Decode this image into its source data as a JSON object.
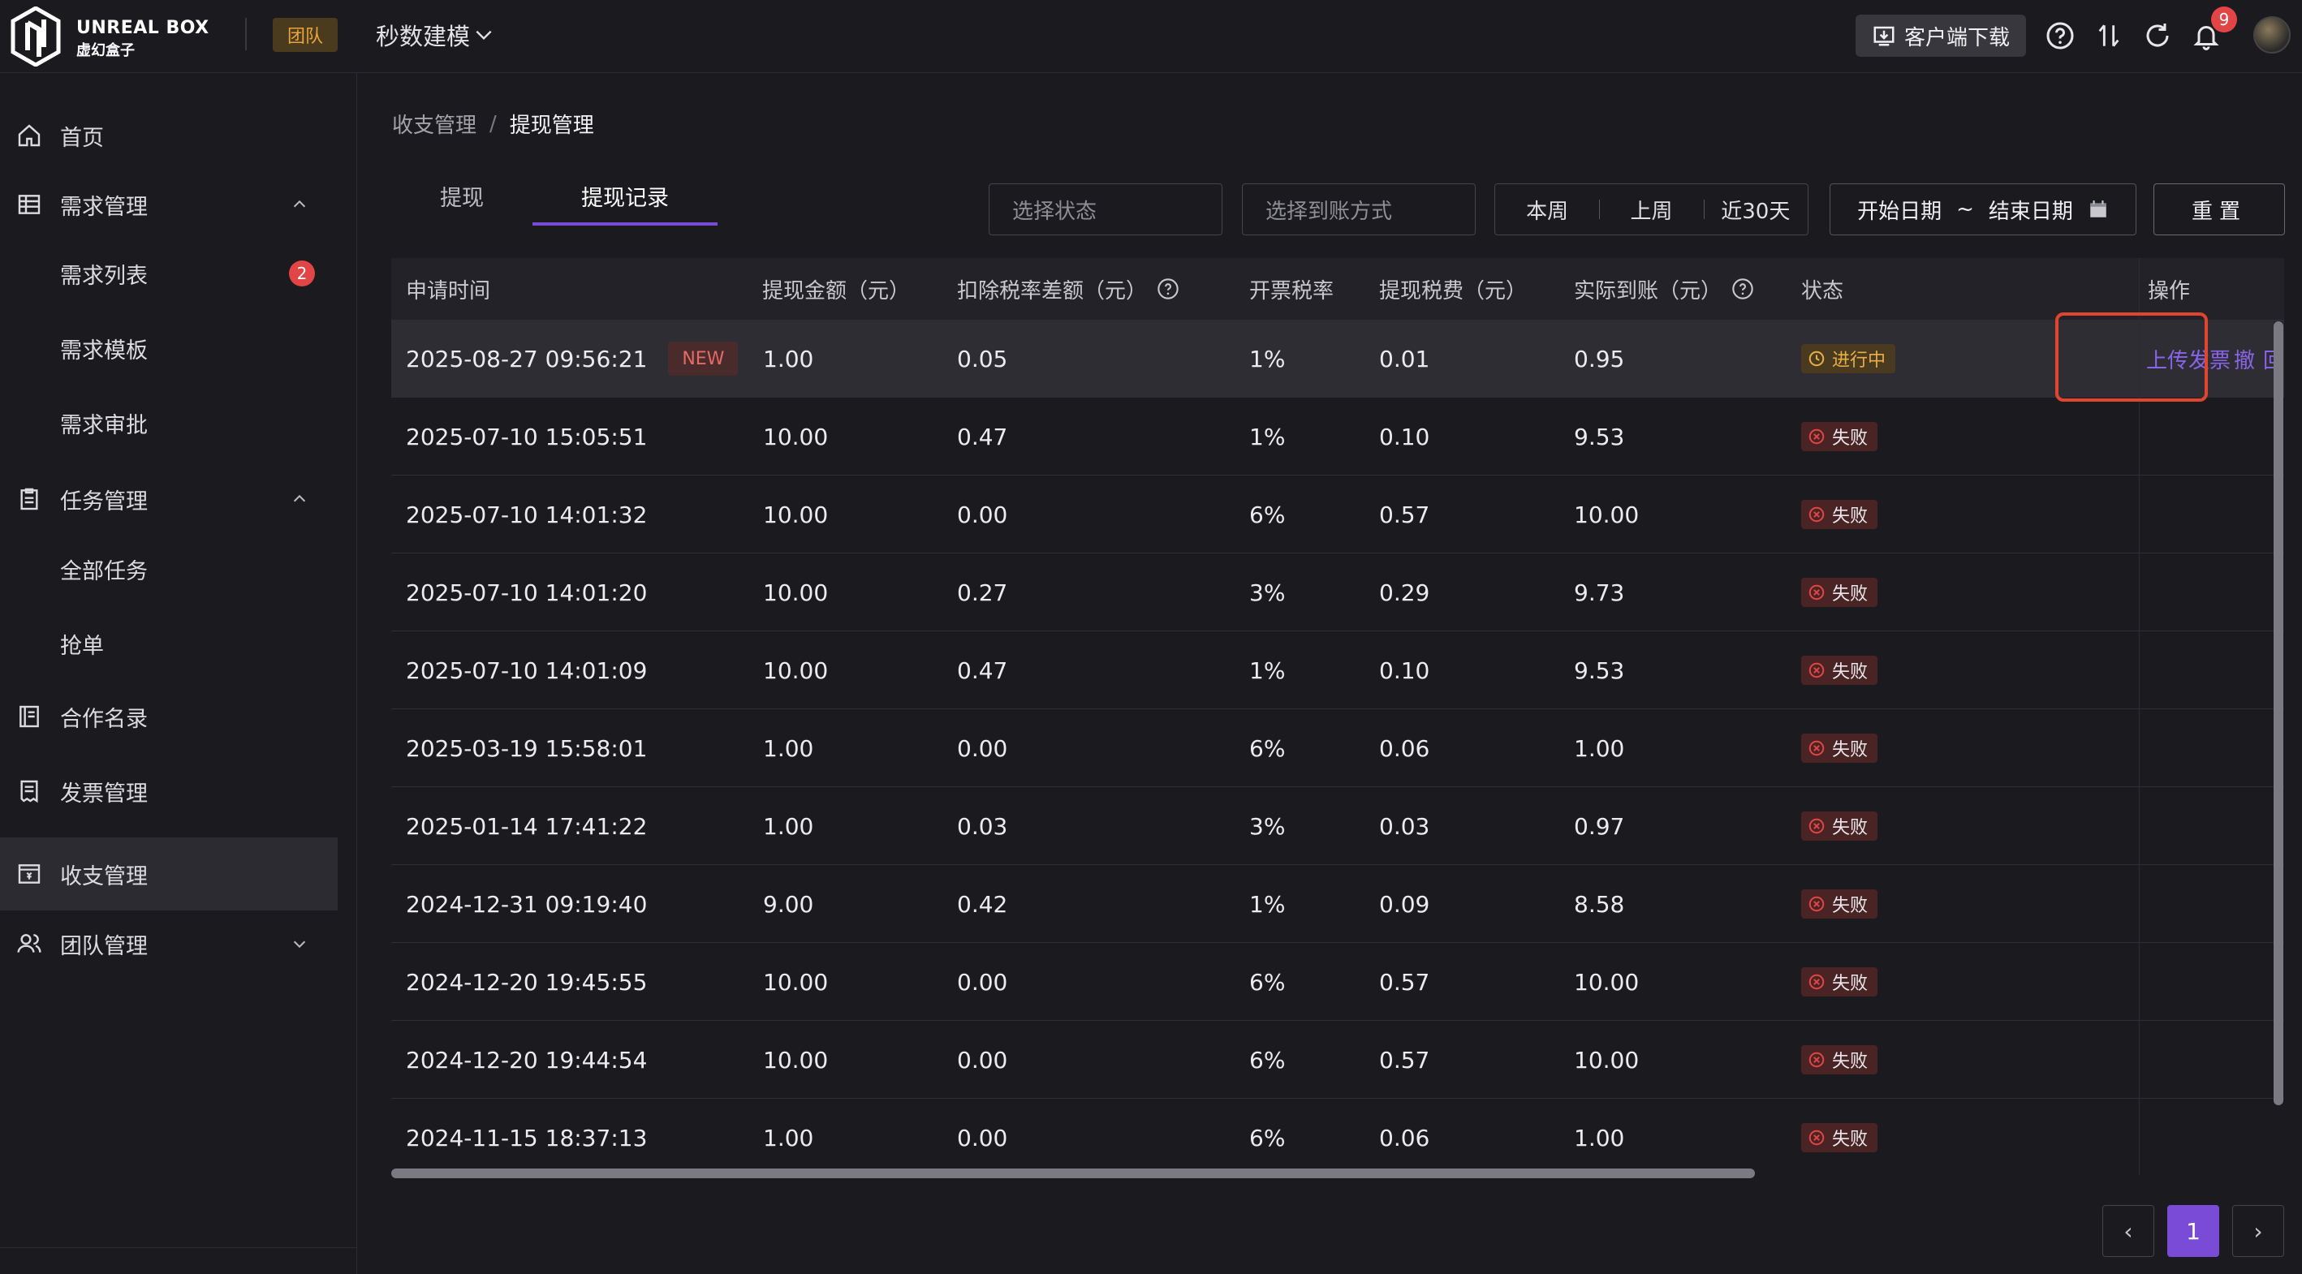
{
  "app": {
    "brand_en": "UNREAL BOX",
    "brand_cn": "虚幻盒子",
    "team_label": "团队",
    "project_name": "秒数建模",
    "download_label": "客户端下载",
    "notification_count": "9"
  },
  "sidebar": {
    "items": [
      {
        "label": "首页",
        "icon": "home-icon"
      },
      {
        "label": "需求管理",
        "icon": "grid-icon",
        "expanded": true
      },
      {
        "label": "需求列表",
        "badge": "2"
      },
      {
        "label": "需求模板"
      },
      {
        "label": "需求审批"
      },
      {
        "label": "任务管理",
        "icon": "clipboard-icon",
        "expanded": true
      },
      {
        "label": "全部任务"
      },
      {
        "label": "抢单"
      },
      {
        "label": "合作名录",
        "icon": "book-icon"
      },
      {
        "label": "发票管理",
        "icon": "receipt-icon"
      },
      {
        "label": "收支管理",
        "icon": "wallet-icon",
        "active": true
      },
      {
        "label": "团队管理",
        "icon": "users-icon",
        "expanded": false
      }
    ]
  },
  "breadcrumb": {
    "parent": "收支管理",
    "separator": "/",
    "current": "提现管理"
  },
  "tabs": [
    {
      "label": "提现",
      "active": false
    },
    {
      "label": "提现记录",
      "active": true
    }
  ],
  "filters": {
    "status_placeholder": "选择状态",
    "method_placeholder": "选择到账方式",
    "quick_ranges": [
      "本周",
      "上周",
      "近30天"
    ],
    "start_date": "开始日期",
    "range_sep": "~",
    "end_date": "结束日期",
    "reset_label": "重置"
  },
  "table": {
    "columns": [
      "申请时间",
      "提现金额（元）",
      "扣除税率差额（元）",
      "开票税率",
      "提现税费（元）",
      "实际到账（元）",
      "状态",
      "操作"
    ],
    "new_tag": "NEW",
    "rows": [
      {
        "time": "2025-08-27 09:56:21",
        "amount": "1.00",
        "diff": "0.05",
        "rate": "1%",
        "fee": "0.01",
        "actual": "0.95",
        "status": "进行中",
        "status_type": "ongoing",
        "actions": [
          "上传发票",
          "撤回"
        ],
        "is_new": true
      },
      {
        "time": "2025-07-10 15:05:51",
        "amount": "10.00",
        "diff": "0.47",
        "rate": "1%",
        "fee": "0.10",
        "actual": "9.53",
        "status": "失败",
        "status_type": "fail"
      },
      {
        "time": "2025-07-10 14:01:32",
        "amount": "10.00",
        "diff": "0.00",
        "rate": "6%",
        "fee": "0.57",
        "actual": "10.00",
        "status": "失败",
        "status_type": "fail"
      },
      {
        "time": "2025-07-10 14:01:20",
        "amount": "10.00",
        "diff": "0.27",
        "rate": "3%",
        "fee": "0.29",
        "actual": "9.73",
        "status": "失败",
        "status_type": "fail"
      },
      {
        "time": "2025-07-10 14:01:09",
        "amount": "10.00",
        "diff": "0.47",
        "rate": "1%",
        "fee": "0.10",
        "actual": "9.53",
        "status": "失败",
        "status_type": "fail"
      },
      {
        "time": "2025-03-19 15:58:01",
        "amount": "1.00",
        "diff": "0.00",
        "rate": "6%",
        "fee": "0.06",
        "actual": "1.00",
        "status": "失败",
        "status_type": "fail"
      },
      {
        "time": "2025-01-14 17:41:22",
        "amount": "1.00",
        "diff": "0.03",
        "rate": "3%",
        "fee": "0.03",
        "actual": "0.97",
        "status": "失败",
        "status_type": "fail"
      },
      {
        "time": "2024-12-31 09:19:40",
        "amount": "9.00",
        "diff": "0.42",
        "rate": "1%",
        "fee": "0.09",
        "actual": "8.58",
        "status": "失败",
        "status_type": "fail"
      },
      {
        "time": "2024-12-20 19:45:55",
        "amount": "10.00",
        "diff": "0.00",
        "rate": "6%",
        "fee": "0.57",
        "actual": "10.00",
        "status": "失败",
        "status_type": "fail"
      },
      {
        "time": "2024-12-20 19:44:54",
        "amount": "10.00",
        "diff": "0.00",
        "rate": "6%",
        "fee": "0.57",
        "actual": "10.00",
        "status": "失败",
        "status_type": "fail"
      },
      {
        "time": "2024-11-15 18:37:13",
        "amount": "1.00",
        "diff": "0.00",
        "rate": "6%",
        "fee": "0.06",
        "actual": "1.00",
        "status": "失败",
        "status_type": "fail"
      }
    ]
  },
  "pagination": {
    "prev": "‹",
    "current": "1",
    "next": "›"
  },
  "colors": {
    "accent": "#7a4bd6",
    "link": "#8a64e8",
    "danger": "#e24545",
    "warning": "#e8b043",
    "highlight_box": "#e04530"
  }
}
